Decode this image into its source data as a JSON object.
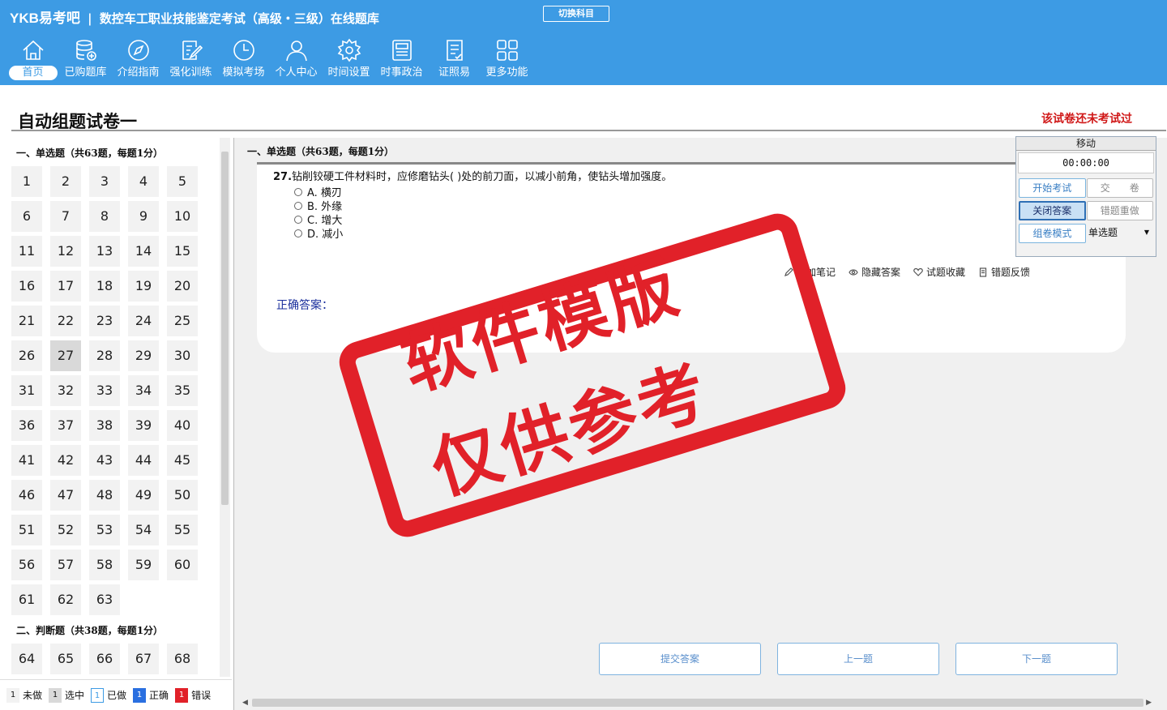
{
  "header": {
    "brand": "YKB易考吧",
    "title": "数控车工职业技能鉴定考试（高级・三级）在线题库",
    "switch_subject": "切换科目"
  },
  "nav": [
    {
      "label": "首页",
      "icon": "home-icon"
    },
    {
      "label": "已购题库",
      "icon": "database-icon"
    },
    {
      "label": "介绍指南",
      "icon": "compass-icon"
    },
    {
      "label": "强化训练",
      "icon": "edit-icon"
    },
    {
      "label": "模拟考场",
      "icon": "clock-icon"
    },
    {
      "label": "个人中心",
      "icon": "user-icon"
    },
    {
      "label": "时间设置",
      "icon": "gear-icon"
    },
    {
      "label": "时事政治",
      "icon": "newspaper-icon"
    },
    {
      "label": "证照易",
      "icon": "certificate-icon"
    },
    {
      "label": "更多功能",
      "icon": "grid-icon"
    }
  ],
  "page": {
    "title": "自动组题试卷一",
    "status": "该试卷还未考试过"
  },
  "sections": {
    "single": "一、单选题（共63题，每题1分）",
    "judge": "二、判断题（共38题，每题1分）"
  },
  "single_numbers": [
    "1",
    "2",
    "3",
    "4",
    "5",
    "6",
    "7",
    "8",
    "9",
    "10",
    "11",
    "12",
    "13",
    "14",
    "15",
    "16",
    "17",
    "18",
    "19",
    "20",
    "21",
    "22",
    "23",
    "24",
    "25",
    "26",
    "27",
    "28",
    "29",
    "30",
    "31",
    "32",
    "33",
    "34",
    "35",
    "36",
    "37",
    "38",
    "39",
    "40",
    "41",
    "42",
    "43",
    "44",
    "45",
    "46",
    "47",
    "48",
    "49",
    "50",
    "51",
    "52",
    "53",
    "54",
    "55",
    "56",
    "57",
    "58",
    "59",
    "60",
    "61",
    "62",
    "63"
  ],
  "judge_numbers": [
    "64",
    "65",
    "66",
    "67",
    "68"
  ],
  "current": "27",
  "legend": [
    {
      "swatch": "1",
      "label": "未做"
    },
    {
      "swatch": "1",
      "label": "选中"
    },
    {
      "swatch": "1",
      "label": "已做"
    },
    {
      "swatch": "1",
      "label": "正确"
    },
    {
      "swatch": "1",
      "label": "错误"
    }
  ],
  "question": {
    "section": "一、单选题（共63题，每题1分）",
    "number": "27.",
    "text": "钻削铰硬工件材料时，应修磨钻头(  )处的前刀面，以减小前角，使钻头增加强度。",
    "options": [
      "A. 横刃",
      "B. 外缘",
      "C. 增大",
      "D. 减小"
    ],
    "answer_label": "正确答案："
  },
  "tools": {
    "note": "添加笔记",
    "hide": "隐藏答案",
    "fav": "试题收藏",
    "feedback": "错题反馈"
  },
  "buttons": {
    "submit": "提交答案",
    "prev": "上一题",
    "next": "下一题"
  },
  "panel": {
    "move": "移动",
    "timer": "00:00:00",
    "start": "开始考试",
    "hand_in": "交　　卷",
    "close_answer": "关闭答案",
    "redo": "错题重做",
    "mode": "组卷模式",
    "type_select": "单选题"
  },
  "watermark": {
    "line1": "软件模版",
    "line2": "仅供参考"
  },
  "colors": {
    "topbar": "#3d9be4",
    "stamp": "#e12129",
    "status": "#d01818"
  }
}
